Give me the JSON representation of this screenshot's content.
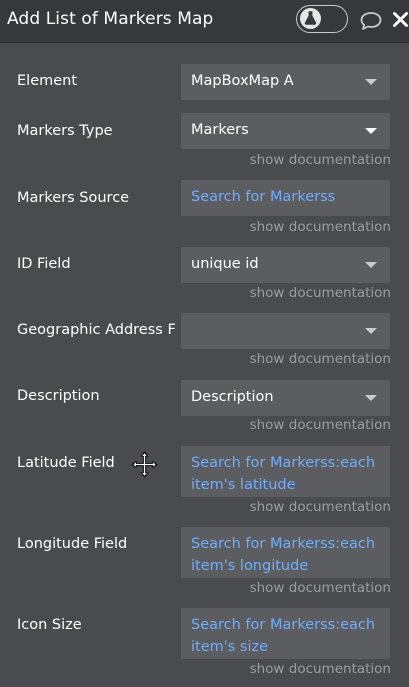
{
  "panel": {
    "title": "Add List of Markers Map"
  },
  "icons": {
    "toggle": "flask-icon",
    "comment": "comment-icon",
    "close": "close-icon",
    "cursor": "move-cursor-icon"
  },
  "fields": [
    {
      "label": "Element",
      "value": "MapBoxMap A",
      "kind": "dropdown"
    },
    {
      "label": "Markers Type",
      "value": "Markers",
      "kind": "dropdown",
      "doc": "show documentation"
    },
    {
      "label": "Markers Source",
      "value": "Search for Markerss",
      "kind": "dynamic",
      "doc": "show documentation"
    },
    {
      "label": "ID Field",
      "value": "unique id",
      "kind": "dropdown",
      "doc": "show documentation"
    },
    {
      "label": "Geographic Address F",
      "value": "",
      "kind": "dropdown",
      "doc": "show documentation"
    },
    {
      "label": "Description",
      "value": "Description",
      "kind": "dropdown",
      "doc": "show documentation"
    },
    {
      "label": "Latitude Field",
      "value_line1": "Search for Markerss:each",
      "value_line2": "item's latitude",
      "kind": "dynamic",
      "doc": "show documentation"
    },
    {
      "label": "Longitude Field",
      "value_line1": "Search for Markerss:each",
      "value_line2": "item's longitude",
      "kind": "dynamic",
      "doc": "show documentation"
    },
    {
      "label": "Icon Size",
      "value_line1": "Search for Markerss:each",
      "value_line2": "item's size",
      "kind": "dynamic",
      "doc": "show documentation"
    }
  ],
  "colors": {
    "panel_bg": "#4a4b4e",
    "header_bg": "#36383b",
    "field_bg": "#5c5d61",
    "dynamic_text": "#6faeff",
    "doc_text": "#9c9da1"
  }
}
